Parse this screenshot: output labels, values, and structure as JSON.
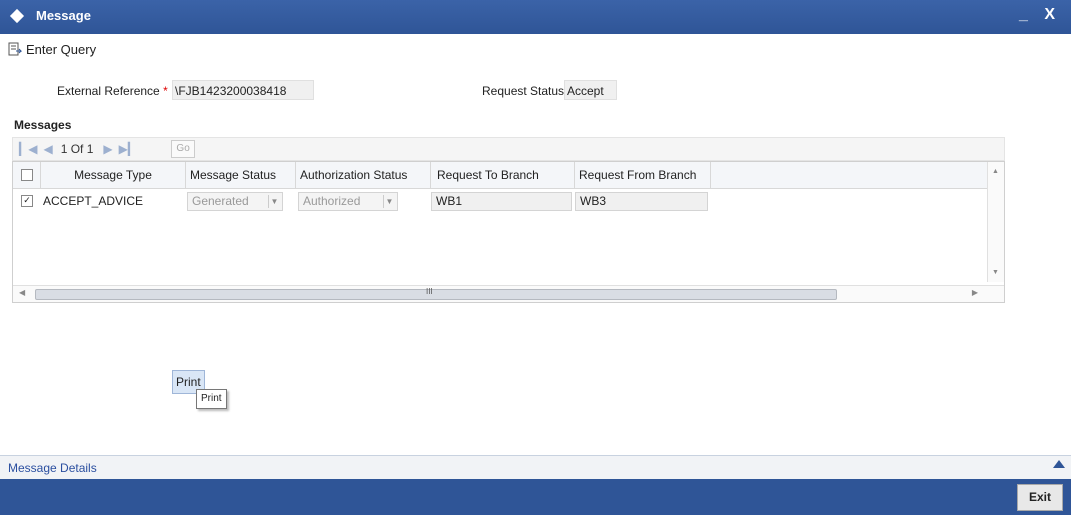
{
  "window": {
    "title": "Message",
    "controls": "_ X"
  },
  "toolbar": {
    "enter_query": "Enter Query"
  },
  "form": {
    "external_reference_label": "External Reference",
    "required_marker": "*",
    "external_reference_value": "\\FJB1423200038418",
    "request_status_label": "Request Status",
    "request_status_value": "Accept"
  },
  "messages": {
    "section_title": "Messages",
    "pager": {
      "text": "1 Of 1",
      "go": "Go"
    },
    "columns": [
      "Message Type",
      "Message Status",
      "Authorization Status",
      "Request To Branch",
      "Request From Branch"
    ],
    "rows": [
      {
        "checked": true,
        "message_type": "ACCEPT_ADVICE",
        "message_status": "Generated",
        "authorization_status": "Authorized",
        "request_to_branch": "WB1",
        "request_from_branch": "WB3"
      }
    ],
    "hscroll_mark": "III"
  },
  "actions": {
    "print": "Print",
    "print_tooltip": "Print"
  },
  "details": {
    "link": "Message Details"
  },
  "footer": {
    "exit": "Exit"
  },
  "colors": {
    "header_blue": "#2f5597",
    "link_blue": "#2b4fa0"
  }
}
